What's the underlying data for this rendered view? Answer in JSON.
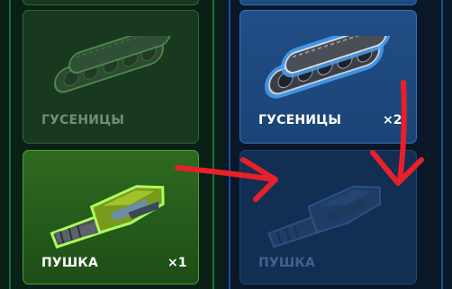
{
  "inventory": {
    "left_column": {
      "items": [
        {
          "label": "",
          "state": "dimmed",
          "icon": "partial-card"
        },
        {
          "label": "ГУСЕНИЦЫ",
          "count": "",
          "state": "dimmed",
          "icon": "tracks-icon"
        },
        {
          "label": "ПУШКА",
          "count": "×1",
          "state": "selected",
          "icon": "cannon-icon"
        }
      ]
    },
    "right_column": {
      "items": [
        {
          "label": "",
          "state": "active",
          "icon": "partial-card"
        },
        {
          "label": "ГУСЕНИЦЫ",
          "count": "×2",
          "state": "active",
          "icon": "tracks-icon"
        },
        {
          "label": "ПУШКА",
          "count": "",
          "state": "dimmed",
          "icon": "cannon-icon"
        }
      ]
    }
  },
  "annotations": {
    "arrow_color": "#e8202a",
    "arrows": [
      "arrow-left-to-right",
      "arrow-down"
    ]
  },
  "colors": {
    "green_card": "#2e6a20",
    "green_dim_card": "#18381f",
    "blue_card": "#214e86",
    "blue_dim_card": "#122e53",
    "selected_glow": "#8cf04a",
    "blue_glow": "#3fa0ff",
    "background": "#081522"
  }
}
